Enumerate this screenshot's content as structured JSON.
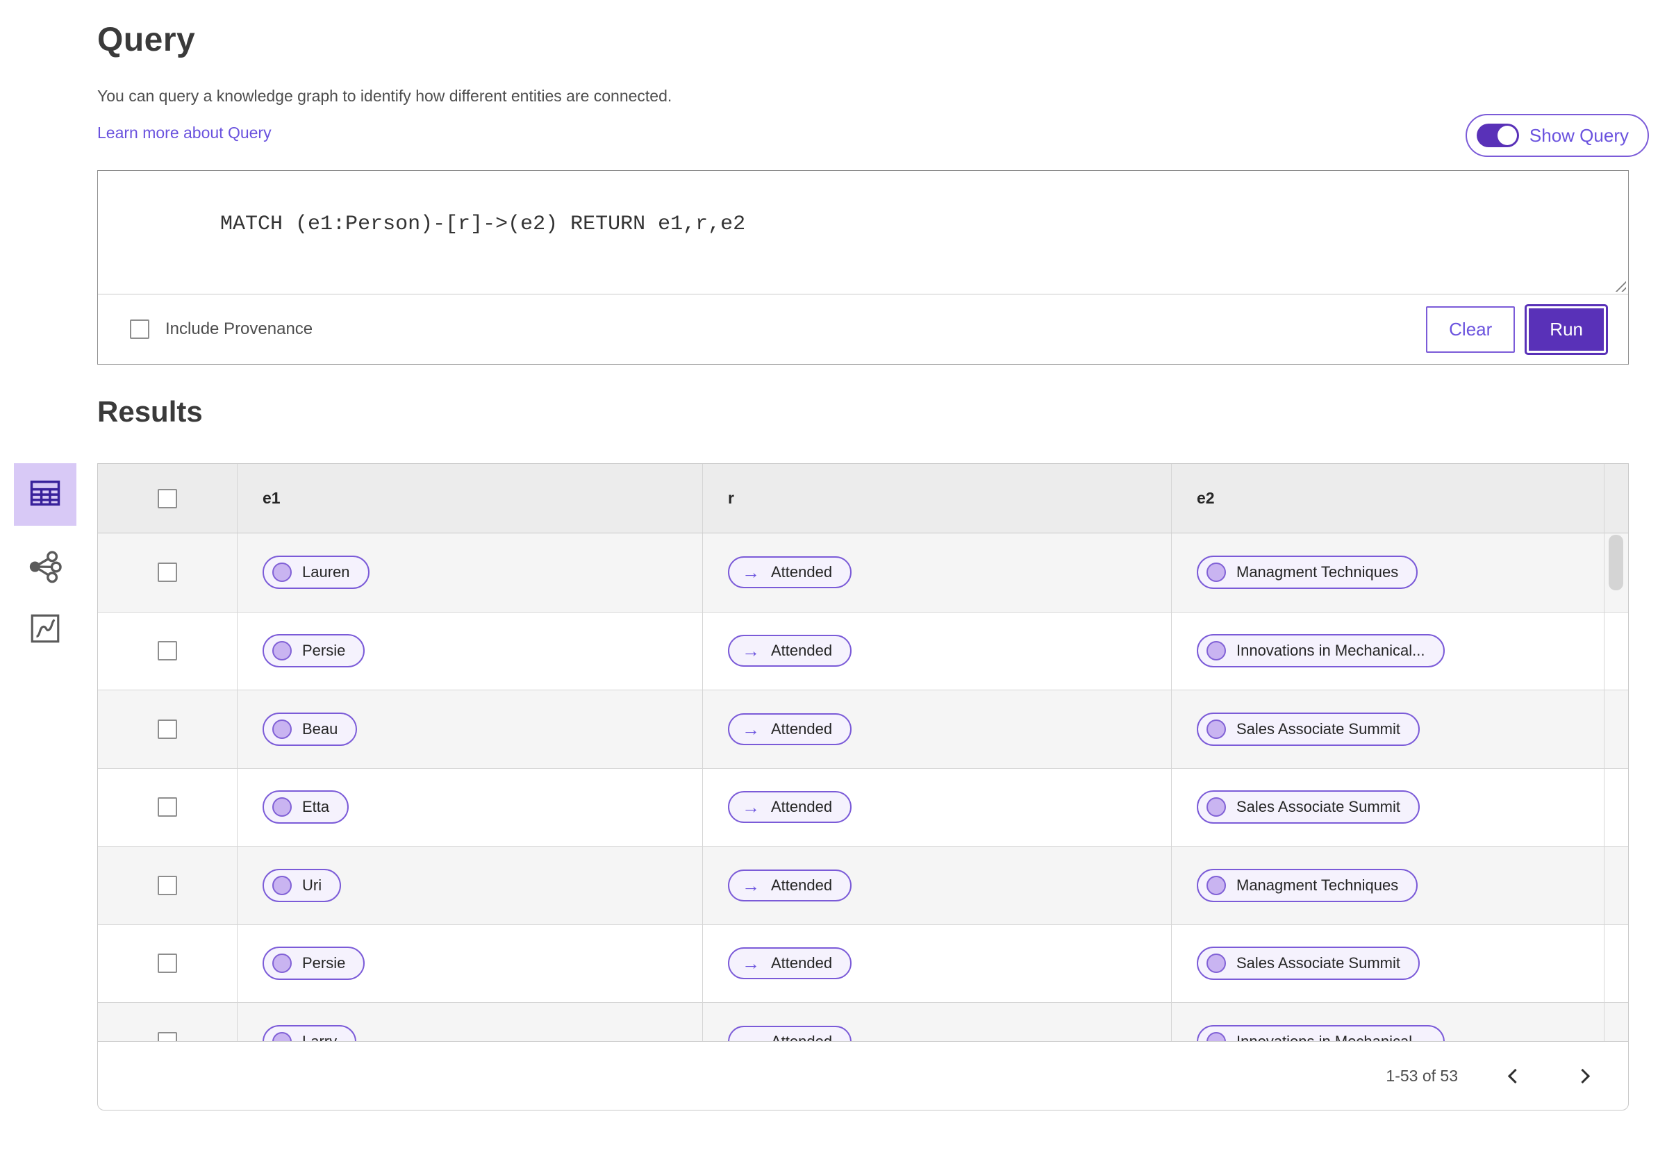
{
  "query": {
    "title": "Query",
    "description": "You can query a knowledge graph to identify how different entities are connected.",
    "learn_more_label": "Learn more about Query",
    "show_query_label": "Show Query",
    "show_query_on": true,
    "query_text": "MATCH (e1:Person)-[r]->(e2) RETURN e1,r,e2",
    "include_provenance_label": "Include Provenance",
    "include_provenance_checked": false,
    "clear_label": "Clear",
    "run_label": "Run"
  },
  "results": {
    "title": "Results",
    "view_modes": [
      "table-view",
      "network-view",
      "chart-view"
    ],
    "active_view": "table-view"
  },
  "table": {
    "columns": [
      "e1",
      "r",
      "e2"
    ],
    "rows": [
      {
        "e1": "Lauren",
        "r": "Attended",
        "e2": "Managment Techniques"
      },
      {
        "e1": "Persie",
        "r": "Attended",
        "e2": "Innovations in Mechanical..."
      },
      {
        "e1": "Beau",
        "r": "Attended",
        "e2": "Sales Associate Summit"
      },
      {
        "e1": "Etta",
        "r": "Attended",
        "e2": "Sales Associate Summit"
      },
      {
        "e1": "Uri",
        "r": "Attended",
        "e2": "Managment Techniques"
      },
      {
        "e1": "Persie",
        "r": "Attended",
        "e2": "Sales Associate Summit"
      },
      {
        "e1": "Larry",
        "r": "Attended",
        "e2": "Innovations in Mechanical..."
      }
    ]
  },
  "pagination": {
    "range_text": "1-53 of 53"
  },
  "icons": {
    "arrow_right": "→"
  },
  "colors": {
    "accent_purple": "#5931B8",
    "pill_border": "#7B5BD8",
    "pill_background": "#F5F2FD",
    "link_purple": "#6A52DE",
    "selected_view_background": "#D8C9F6",
    "header_background": "#ECECEC",
    "stripe_background": "#F5F5F5"
  }
}
